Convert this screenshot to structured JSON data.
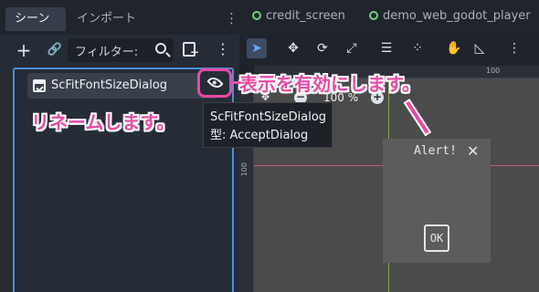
{
  "left_dock": {
    "tabs": [
      {
        "label": "シーン",
        "active": true
      },
      {
        "label": "インポート",
        "active": false
      }
    ],
    "menu_glyph": "⋮",
    "toolbar": {
      "add_glyph": "+",
      "link_glyph": "🔗",
      "filter_placeholder": "フィルター:",
      "menu_glyph": "⋮"
    }
  },
  "scene_tree": {
    "node": {
      "name": "ScFitFontSizeDialog",
      "icon": "accept-dialog-icon",
      "visible": true
    }
  },
  "tooltip": {
    "line1": "ScFitFontSizeDialog",
    "line2": "型: AcceptDialog"
  },
  "editor": {
    "tabs": [
      {
        "label": "credit_screen",
        "icon": "scene-icon"
      },
      {
        "label": "demo_web_godot_player",
        "icon": "scene-icon"
      }
    ],
    "tools": {
      "select": "➤",
      "move": "✥",
      "rotate": "⟳",
      "scale": "⤢",
      "list": "☰",
      "pivot": "⁘",
      "pan": "✋",
      "ruler": "◺",
      "snap": "⋮"
    },
    "ruler_top_label": "100",
    "ruler_left_label": "100",
    "zoom": {
      "icon": "✥",
      "minus": "−",
      "level": "100 %",
      "plus": "+"
    },
    "dialog_preview": {
      "title": "Alert!",
      "close": "✕",
      "ok": "OK"
    }
  },
  "annotations": {
    "enable": "表示を有効にします。",
    "rename": "リネームします。",
    "color": "#e84aa4"
  },
  "colors": {
    "accent_selection": "#4d8fd6",
    "scene_tab_dot": "#6ed37a",
    "annotation": "#e84aa4"
  }
}
